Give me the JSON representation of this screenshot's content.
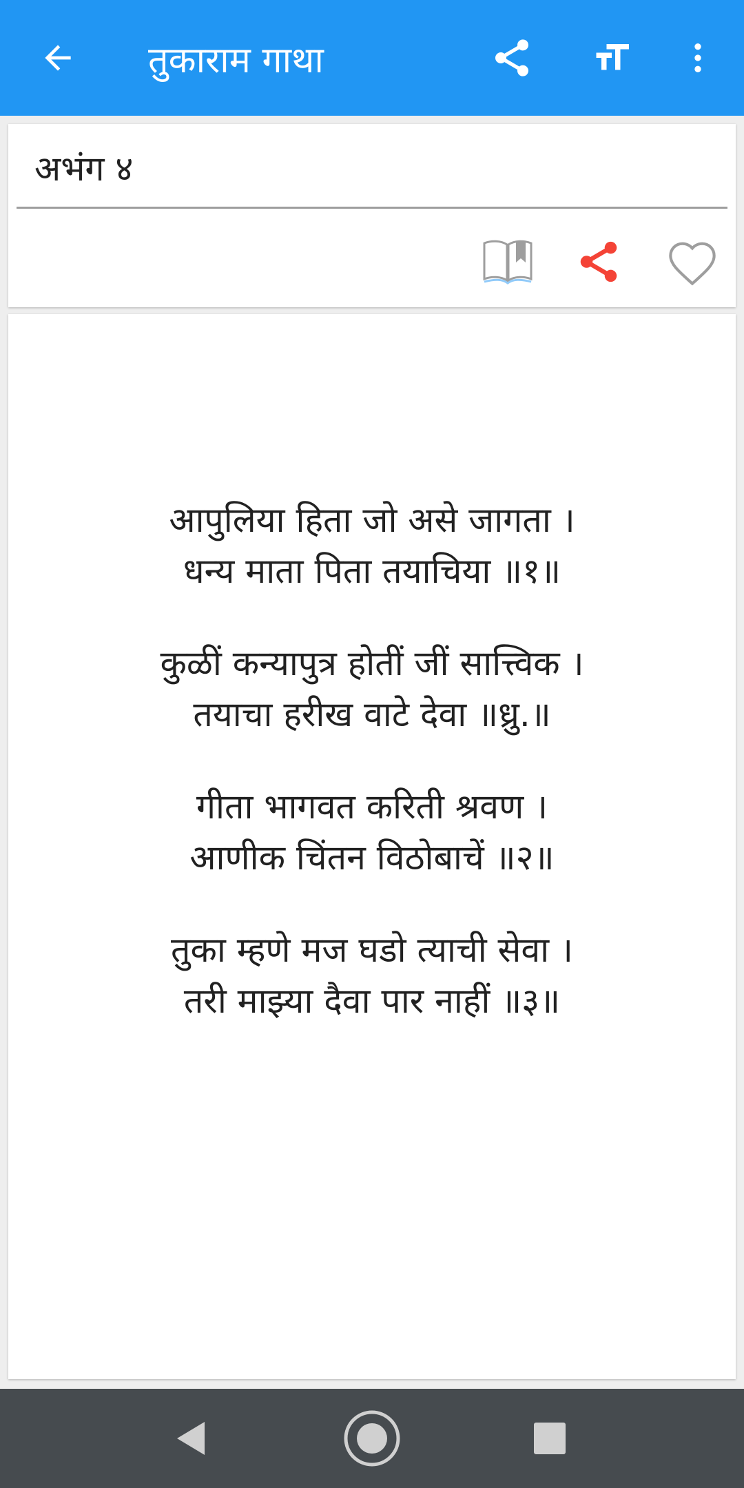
{
  "app": {
    "title": "तुकाराम गाथा",
    "accent_color": "#2196f3",
    "share_accent_color": "#f44336"
  },
  "toolbar": {
    "icons": [
      "back-arrow-icon",
      "share-icon",
      "text-size-icon",
      "more-vert-icon"
    ]
  },
  "abhang": {
    "title": "अभंग  ४",
    "actions": [
      "book-bookmark-icon",
      "share-icon",
      "heart-icon"
    ],
    "stanzas": [
      [
        "आपुलिया हिता जो असे जागता ।",
        "धन्य माता पिता तयाचिया ॥१॥"
      ],
      [
        "कुळीं कन्यापुत्र होतीं जीं सात्त्विक ।",
        "तयाचा हरीख वाटे देवा ॥ध्रु.॥"
      ],
      [
        "गीता भागवत करिती श्रवण ।",
        "आणीक चिंतन विठोबाचें ॥२॥"
      ],
      [
        "तुका म्हणे मज घडो त्याची सेवा ।",
        "तरी माझ्या दैवा पार नाहीं ॥३॥"
      ]
    ]
  },
  "system_nav": {
    "buttons": [
      "nav-back-icon",
      "nav-home-icon",
      "nav-recents-icon"
    ],
    "background": "#464b4f"
  }
}
